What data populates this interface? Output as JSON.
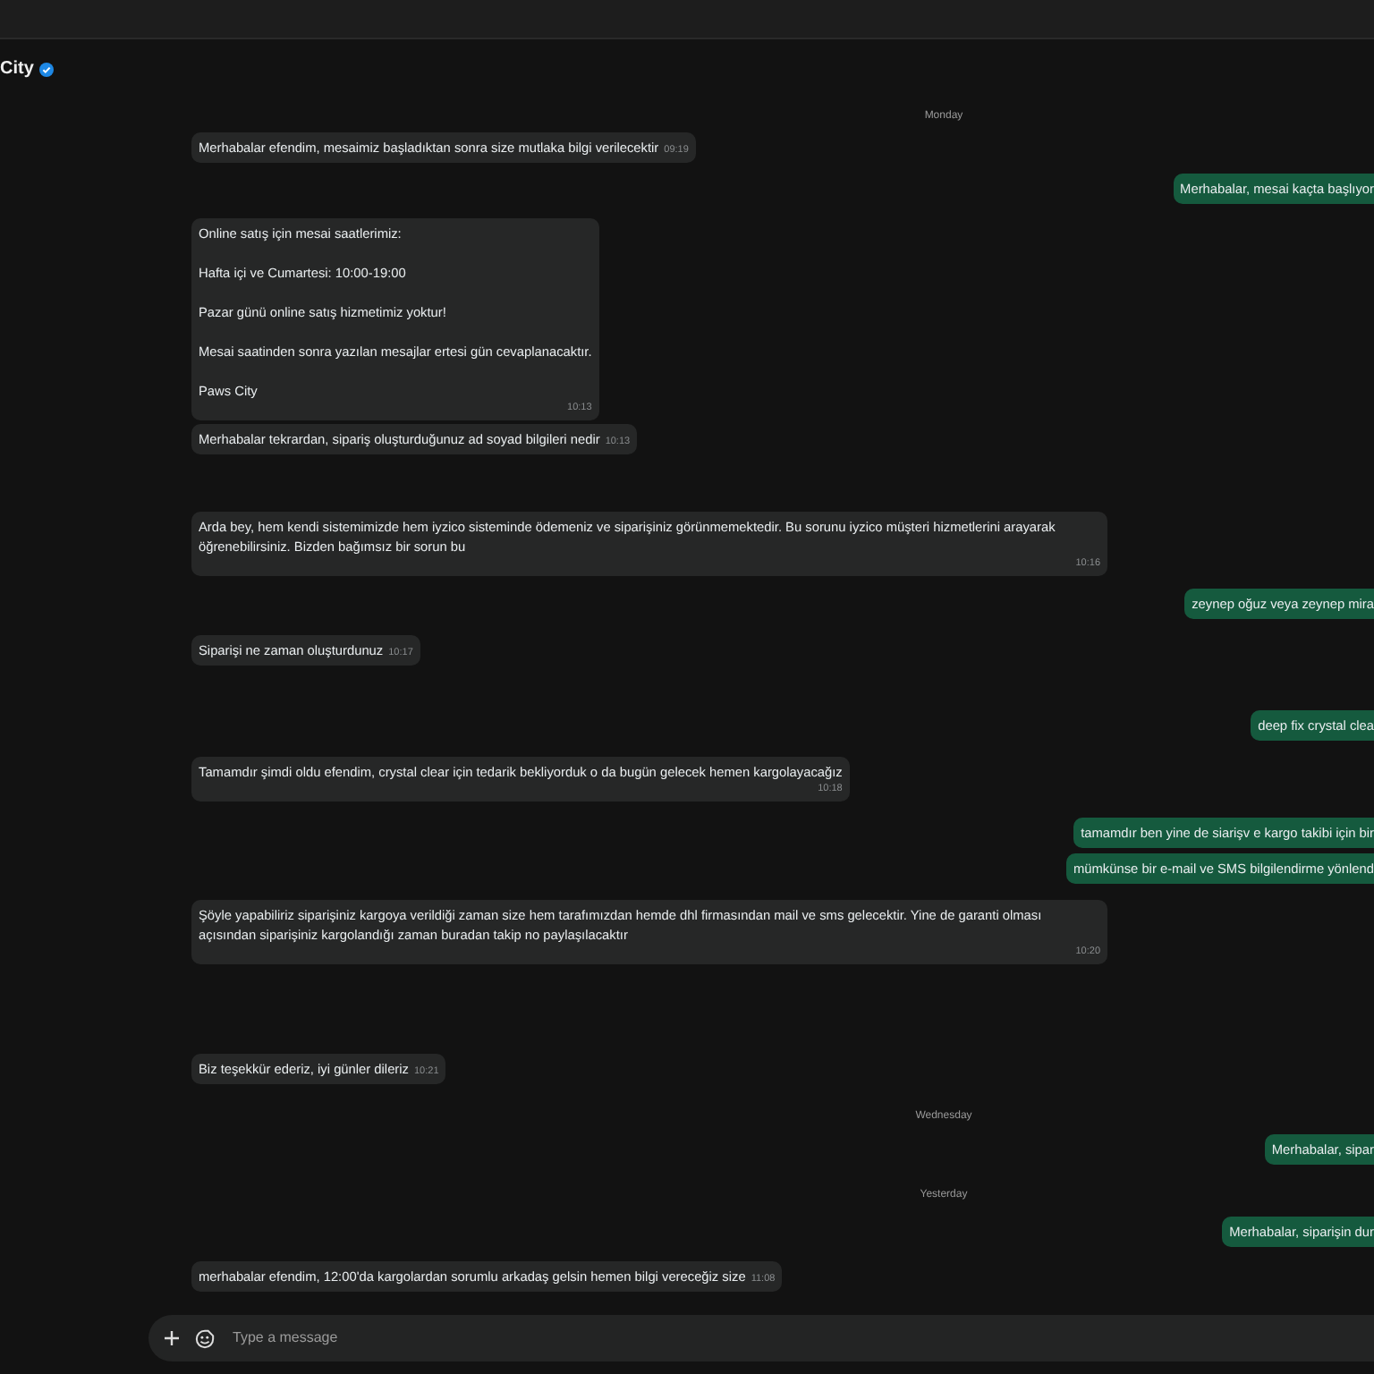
{
  "chat": {
    "name": "City",
    "verified": true
  },
  "messages": [
    {
      "kind": "date",
      "text": "Monday"
    },
    {
      "kind": "in",
      "text": "Merhabalar efendim, mesaimiz başladıktan sonra size mutlaka bilgi verilecektir",
      "time": "09:19"
    },
    {
      "kind": "out",
      "text": "Merhabalar, mesai kaçta başlıyor"
    },
    {
      "kind": "in",
      "text": "Online satış için mesai saatlerimiz:\n\nHafta içi ve Cumartesi: 10:00-19:00\n\nPazar günü online satış hizmetimiz yoktur!\n\nMesai saatinden sonra yazılan mesajlar ertesi gün cevaplanacaktır.\n\nPaws City",
      "time": "10:13"
    },
    {
      "kind": "in",
      "text": "Merhabalar tekrardan, sipariş oluşturduğunuz ad soyad bilgileri nedir",
      "time": "10:13"
    },
    {
      "kind": "in",
      "text": "Arda bey, hem kendi sistemimizde hem iyzico sisteminde ödemeniz ve siparişiniz görünmemektedir. Bu sorunu iyzico müşteri hizmetlerini arayarak öğrenebilirsiniz. Bizden bağımsız bir sorun bu",
      "time": "10:16"
    },
    {
      "kind": "out",
      "text": "zeynep oğuz veya zeynep mira"
    },
    {
      "kind": "in",
      "text": "Siparişi ne zaman oluşturdunuz",
      "time": "10:17"
    },
    {
      "kind": "out",
      "text": "deep fix crystal clea"
    },
    {
      "kind": "in",
      "text": "Tamamdır şimdi oldu efendim, crystal clear için tedarik bekliyorduk o da bugün gelecek hemen kargolayacağız",
      "time": "10:18"
    },
    {
      "kind": "out",
      "text": "tamamdır ben yine de siarişv e kargo takibi için bir"
    },
    {
      "kind": "out",
      "text": "mümkünse bir e-mail ve SMS bilgilendirme yönlend"
    },
    {
      "kind": "in",
      "text": "Şöyle yapabiliriz siparişiniz kargoya verildiği zaman size hem tarafımızdan hemde dhl firmasından mail ve sms gelecektir. Yine de garanti olması açısından siparişiniz kargolandığı zaman buradan takip no paylaşılacaktır",
      "time": "10:20"
    },
    {
      "kind": "in",
      "text": "Biz teşekkür ederiz, iyi günler dileriz",
      "time": "10:21"
    },
    {
      "kind": "date",
      "text": "Wednesday"
    },
    {
      "kind": "out",
      "text": "Merhabalar, sipar"
    },
    {
      "kind": "date",
      "text": "Yesterday"
    },
    {
      "kind": "out",
      "text": "Merhabalar, siparişin dur"
    },
    {
      "kind": "in",
      "text": "merhabalar efendim, 12:00'da kargolardan sorumlu arkadaş gelsin hemen bilgi vereceğiz size",
      "time": "11:08"
    }
  ],
  "composer": {
    "placeholder": "Type a message"
  }
}
